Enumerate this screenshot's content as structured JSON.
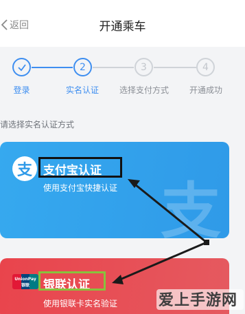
{
  "nav": {
    "back_label": "返回",
    "title": "开通乘车"
  },
  "steps": [
    {
      "num": "",
      "label": "登录",
      "state": "done"
    },
    {
      "num": "2",
      "label": "实名认证",
      "state": "current"
    },
    {
      "num": "3",
      "label": "选择支付方式",
      "state": "pending"
    },
    {
      "num": "4",
      "label": "开通成功",
      "state": "pending"
    }
  ],
  "hint": "请选择实名认证方式",
  "alipay_card": {
    "title": "支付宝认证",
    "subtitle": "使用支付宝快捷认证",
    "logo_char": "支",
    "watermark_char": "支"
  },
  "union_card": {
    "title": "银联认证",
    "subtitle": "使用银联卡实名验证",
    "logo_text": "UnionPay 银联"
  },
  "brand_watermark": "爱上手游网",
  "colors": {
    "accent": "#3e8ef0",
    "alipay": "#2f9ae8",
    "union": "#e9444c",
    "highlight_green": "#88c23c"
  }
}
